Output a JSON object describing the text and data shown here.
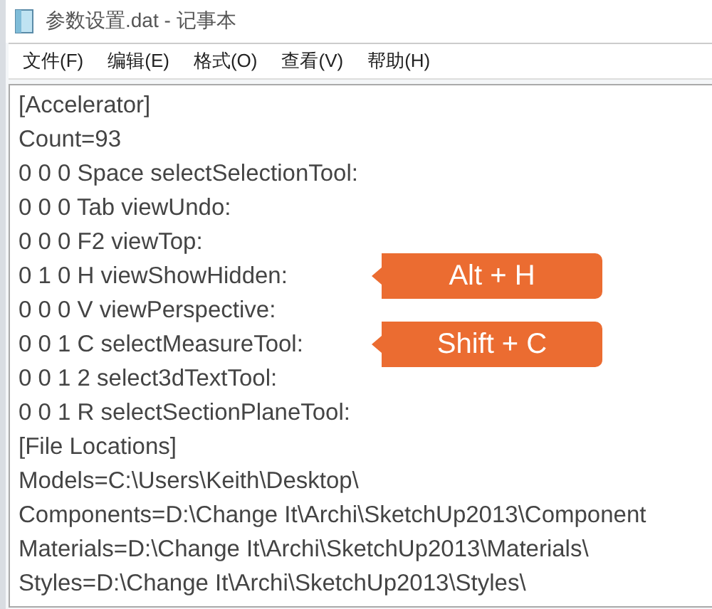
{
  "window": {
    "title": "参数设置.dat - 记事本"
  },
  "menu": [
    "文件(F)",
    "编辑(E)",
    "格式(O)",
    "查看(V)",
    "帮助(H)"
  ],
  "lines": [
    {
      "text": "[Accelerator]"
    },
    {
      "text": "Count=93"
    },
    {
      "text": "0 0 0 Space selectSelectionTool:"
    },
    {
      "text": "0 0 0 Tab viewUndo:"
    },
    {
      "text": "0 0 0 F2 viewTop:"
    },
    {
      "text": "0 1 0 H viewShowHidden:",
      "callout": "Alt + H"
    },
    {
      "text": "0 0 0 V viewPerspective:"
    },
    {
      "text": "0 0 1 C selectMeasureTool:",
      "callout": "Shift + C"
    },
    {
      "text": "0 0 1 2 select3dTextTool:"
    },
    {
      "text": "0 0 1 R selectSectionPlaneTool:"
    },
    {
      "text": "[File Locations]"
    },
    {
      "text": "Models=C:\\Users\\Keith\\Desktop\\"
    },
    {
      "text": "Components=D:\\Change It\\Archi\\SketchUp2013\\Component"
    },
    {
      "text": "Materials=D:\\Change It\\Archi\\SketchUp2013\\Materials\\"
    },
    {
      "text": "Styles=D:\\Change It\\Archi\\SketchUp2013\\Styles\\"
    }
  ]
}
